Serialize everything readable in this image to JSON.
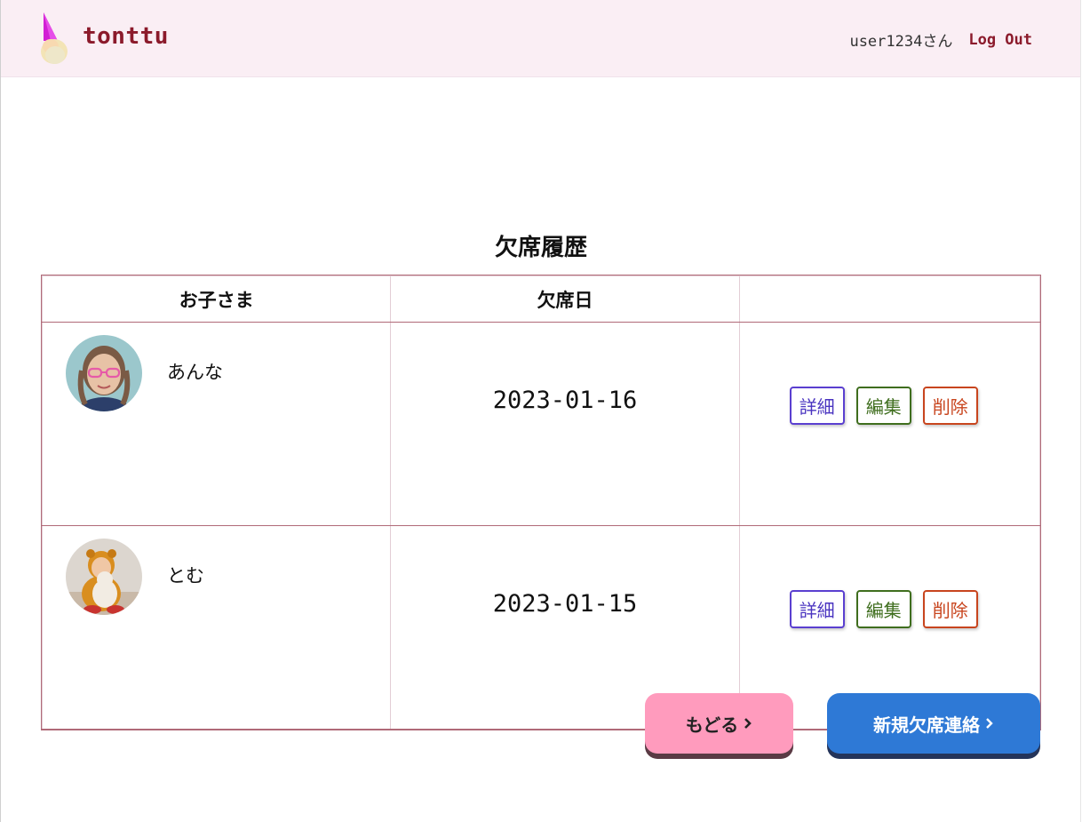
{
  "header": {
    "app_name": "tonttu",
    "username": "user1234さん",
    "logout_label": "Log Out"
  },
  "page": {
    "title": "欠席履歴"
  },
  "table": {
    "columns": [
      "お子さま",
      "欠席日",
      ""
    ],
    "rows": [
      {
        "child_name": "あんな",
        "date": "2023-01-16",
        "detail_label": "詳細",
        "edit_label": "編集",
        "delete_label": "削除"
      },
      {
        "child_name": "とむ",
        "date": "2023-01-15",
        "detail_label": "詳細",
        "edit_label": "編集",
        "delete_label": "削除"
      }
    ]
  },
  "actions": {
    "back_label": "もどる",
    "back_icon": "chevron-right-icon",
    "new_label": "新規欠席連絡",
    "new_icon": "chevron-right-icon"
  },
  "colors": {
    "header_bg": "#faeef4",
    "brand": "#8b1a2b",
    "back_button": "#ff9bbd",
    "new_button": "#2e79d6",
    "detail": "#4a34c0",
    "edit": "#3f6e1e",
    "delete": "#c8451e"
  }
}
